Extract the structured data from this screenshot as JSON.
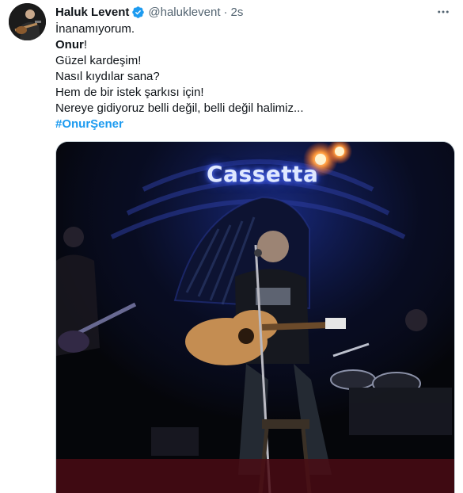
{
  "author": {
    "name": "Haluk Levent",
    "handle": "@haluklevent",
    "separator": "·",
    "time": "2s",
    "verified": true,
    "avatar_icon": "avatar-guitarist-icon"
  },
  "tweet": {
    "lines": [
      "İnanamıyorum.",
      "Onur",
      "!",
      "Güzel kardeşim!",
      "Nasıl kıydılar sana?",
      "Hem de bir istek şarkısı için!",
      "Nereye gidiyoruz belli değil, belli değil halimiz..."
    ],
    "hashtag": "#OnurŞener"
  },
  "media": {
    "sign_text": "Cassetta"
  },
  "icons": {
    "verified": "verified-badge-icon",
    "more": "more-options-icon"
  },
  "colors": {
    "accent": "#1d9bf0",
    "secondary_text": "#536471",
    "primary_text": "#0f1419"
  }
}
